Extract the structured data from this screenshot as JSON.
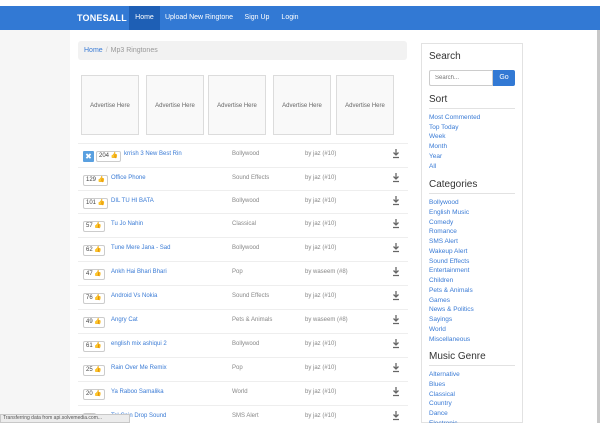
{
  "nav": {
    "brand": "TONESALL",
    "items": [
      {
        "label": "Home",
        "active": true
      },
      {
        "label": "Upload New Ringtone",
        "active": false
      },
      {
        "label": "Sign Up",
        "active": false
      },
      {
        "label": "Login",
        "active": false
      }
    ]
  },
  "breadcrumb": {
    "home": "Home",
    "separator": "/",
    "current": "Mp3 Ringtones"
  },
  "ads": [
    "Advertise Here",
    "Advertise Here",
    "Advertise Here",
    "Advertise Here",
    "Advertise Here"
  ],
  "ringtones": [
    {
      "count": "204",
      "title": "krrish 3 New Best Rin",
      "category": "Bollywood",
      "by": "by jaz (#10)"
    },
    {
      "count": "129",
      "title": "Office Phone",
      "category": "Sound Effects",
      "by": "by jaz (#10)"
    },
    {
      "count": "101",
      "title": "DIL TU HI BATA",
      "category": "Bollywood",
      "by": "by jaz (#10)"
    },
    {
      "count": "57",
      "title": "Tu Jo Nahin",
      "category": "Classical",
      "by": "by jaz (#10)"
    },
    {
      "count": "62",
      "title": "Tune Mere Jana - Sad",
      "category": "Bollywood",
      "by": "by jaz (#10)"
    },
    {
      "count": "47",
      "title": "Ankh Hai Bhari Bhari",
      "category": "Pop",
      "by": "by waseem (#8)"
    },
    {
      "count": "76",
      "title": "Android Vs Nokia",
      "category": "Sound Effects",
      "by": "by jaz (#10)"
    },
    {
      "count": "49",
      "title": "Angry Cat",
      "category": "Pets & Animals",
      "by": "by waseem (#8)"
    },
    {
      "count": "61",
      "title": "english mix ashiqui 2",
      "category": "Bollywood",
      "by": "by jaz (#10)"
    },
    {
      "count": "25",
      "title": "Rain Over Me Remix",
      "category": "Pop",
      "by": "by jaz (#10)"
    },
    {
      "count": "20",
      "title": "Ya Raboo Samalika",
      "category": "World",
      "by": "by jaz (#10)"
    },
    {
      "count": "",
      "title": "Tel Coin Drop Sound",
      "category": "SMS Alert",
      "by": "by jaz (#10)"
    }
  ],
  "sidebar": {
    "search_heading": "Search",
    "search_placeholder": "Search...",
    "search_button": "Go",
    "sort_heading": "Sort",
    "sort_items": [
      "Most Commented",
      "Top Today",
      "Week",
      "Month",
      "Year",
      "All"
    ],
    "categories_heading": "Categories",
    "categories": [
      "Bollywood",
      "English Music",
      "Comedy",
      "Romance",
      "SMS Alert",
      "Wakeup Alert",
      "Sound Effects",
      "Entertainment",
      "Children",
      "Pets & Animals",
      "Games",
      "News & Politics",
      "Sayings",
      "World",
      "Miscellaneous"
    ],
    "genre_heading": "Music Genre",
    "genres": [
      "Alternative",
      "Blues",
      "Classical",
      "Country",
      "Dance",
      "Electronic"
    ]
  },
  "status": "Transferring data from api.solvemedia.com...",
  "colors": {
    "accent": "#3279d4",
    "link": "#3a7bd5"
  }
}
